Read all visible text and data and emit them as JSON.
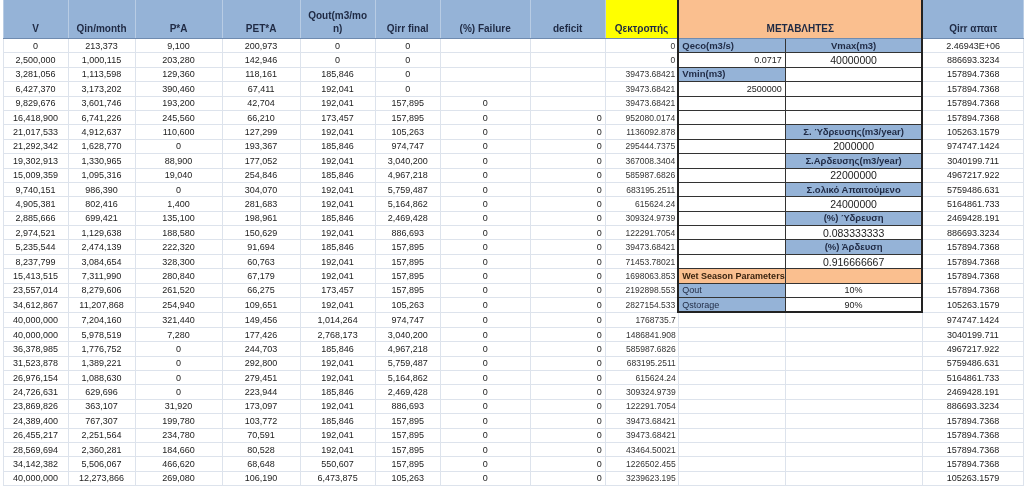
{
  "columns": [
    {
      "label": "V",
      "color": "#95b3d7",
      "kind": "data"
    },
    {
      "label": "Qin/month",
      "color": "#95b3d7",
      "kind": "data"
    },
    {
      "label": "P*A",
      "color": "#95b3d7",
      "kind": "data"
    },
    {
      "label": "PET*A",
      "color": "#95b3d7",
      "kind": "data"
    },
    {
      "label": "Qout(m3/mon)",
      "color": "#95b3d7",
      "kind": "data"
    },
    {
      "label": "Qirr final",
      "color": "#95b3d7",
      "kind": "data"
    },
    {
      "label": "(%) Failure",
      "color": "#95b3d7",
      "kind": "data"
    },
    {
      "label": "deficit",
      "color": "#95b3d7",
      "kind": "data"
    },
    {
      "label": "Qεκτροπής",
      "color": "#ffff00",
      "kind": "data"
    },
    {
      "label": "ΜΕΤΑΒΛΗΤΕΣ",
      "color": "#fabf8f",
      "kind": "group"
    },
    {
      "label": "Qirr απαιτ",
      "color": "#95b3d7",
      "kind": "data"
    }
  ],
  "rows": [
    [
      "0",
      "213,373",
      "9,100",
      "200,973",
      "0",
      "0",
      null,
      null,
      "0",
      "2.46943E+06"
    ],
    [
      "2,500,000",
      "1,000,115",
      "203,280",
      "142,946",
      "0",
      "0",
      null,
      null,
      "0",
      "886693.3234"
    ],
    [
      "3,281,056",
      "1,113,598",
      "129,360",
      "118,161",
      "185,846",
      "0",
      null,
      null,
      "39473.68421",
      "157894.7368"
    ],
    [
      "6,427,370",
      "3,173,202",
      "390,460",
      "67,411",
      "192,041",
      "0",
      null,
      null,
      "39473.68421",
      "157894.7368"
    ],
    [
      "9,829,676",
      "3,601,746",
      "193,200",
      "42,704",
      "192,041",
      "157,895",
      "0",
      null,
      "39473.68421",
      "157894.7368"
    ],
    [
      "16,418,900",
      "6,741,226",
      "245,560",
      "66,210",
      "173,457",
      "157,895",
      "0",
      "0",
      "952080.0174",
      "157894.7368"
    ],
    [
      "21,017,533",
      "4,912,637",
      "110,600",
      "127,299",
      "192,041",
      "105,263",
      "0",
      "0",
      "1136092.878",
      "105263.1579"
    ],
    [
      "21,292,342",
      "1,628,770",
      "0",
      "193,367",
      "185,846",
      "974,747",
      "0",
      "0",
      "295444.7375",
      "974747.1424"
    ],
    [
      "19,302,913",
      "1,330,965",
      "88,900",
      "177,052",
      "192,041",
      "3,040,200",
      "0",
      "0",
      "367008.3404",
      "3040199.711"
    ],
    [
      "15,009,359",
      "1,095,316",
      "19,040",
      "254,846",
      "185,846",
      "4,967,218",
      "0",
      "0",
      "585987.6826",
      "4967217.922"
    ],
    [
      "9,740,151",
      "986,390",
      "0",
      "304,070",
      "192,041",
      "5,759,487",
      "0",
      "0",
      "683195.2511",
      "5759486.631"
    ],
    [
      "4,905,381",
      "802,416",
      "1,400",
      "281,683",
      "192,041",
      "5,164,862",
      "0",
      "0",
      "615624.24",
      "5164861.733"
    ],
    [
      "2,885,666",
      "699,421",
      "135,100",
      "198,961",
      "185,846",
      "2,469,428",
      "0",
      "0",
      "309324.9739",
      "2469428.191"
    ],
    [
      "2,974,521",
      "1,129,638",
      "188,580",
      "150,629",
      "192,041",
      "886,693",
      "0",
      "0",
      "122291.7054",
      "886693.3234"
    ],
    [
      "5,235,544",
      "2,474,139",
      "222,320",
      "91,694",
      "185,846",
      "157,895",
      "0",
      "0",
      "39473.68421",
      "157894.7368"
    ],
    [
      "8,237,799",
      "3,084,654",
      "328,300",
      "60,763",
      "192,041",
      "157,895",
      "0",
      "0",
      "71453.78021",
      "157894.7368"
    ],
    [
      "15,413,515",
      "7,311,990",
      "280,840",
      "67,179",
      "192,041",
      "157,895",
      "0",
      "0",
      "1698063.853",
      "157894.7368"
    ],
    [
      "23,557,014",
      "8,279,606",
      "261,520",
      "66,275",
      "173,457",
      "157,895",
      "0",
      "0",
      "2192898.553",
      "157894.7368"
    ],
    [
      "34,612,867",
      "11,207,868",
      "254,940",
      "109,651",
      "192,041",
      "105,263",
      "0",
      "0",
      "2827154.533",
      "105263.1579"
    ],
    [
      "40,000,000",
      "7,204,160",
      "321,440",
      "149,456",
      "1,014,264",
      "974,747",
      "0",
      "0",
      "1768735.7",
      "974747.1424"
    ],
    [
      "40,000,000",
      "5,978,519",
      "7,280",
      "177,426",
      "2,768,173",
      "3,040,200",
      "0",
      "0",
      "1486841.908",
      "3040199.711"
    ],
    [
      "36,378,985",
      "1,776,752",
      "0",
      "244,703",
      "185,846",
      "4,967,218",
      "0",
      "0",
      "585987.6826",
      "4967217.922"
    ],
    [
      "31,523,878",
      "1,389,221",
      "0",
      "292,800",
      "192,041",
      "5,759,487",
      "0",
      "0",
      "683195.2511",
      "5759486.631"
    ],
    [
      "26,976,154",
      "1,088,630",
      "0",
      "279,451",
      "192,041",
      "5,164,862",
      "0",
      "0",
      "615624.24",
      "5164861.733"
    ],
    [
      "24,726,631",
      "629,696",
      "0",
      "223,944",
      "185,846",
      "2,469,428",
      "0",
      "0",
      "309324.9739",
      "2469428.191"
    ],
    [
      "23,869,826",
      "363,107",
      "31,920",
      "173,097",
      "192,041",
      "886,693",
      "0",
      "0",
      "122291.7054",
      "886693.3234"
    ],
    [
      "24,389,400",
      "767,307",
      "199,780",
      "103,772",
      "185,846",
      "157,895",
      "0",
      "0",
      "39473.68421",
      "157894.7368"
    ],
    [
      "26,455,217",
      "2,251,564",
      "234,780",
      "70,591",
      "192,041",
      "157,895",
      "0",
      "0",
      "39473.68421",
      "157894.7368"
    ],
    [
      "28,569,694",
      "2,360,281",
      "184,660",
      "80,528",
      "192,041",
      "157,895",
      "0",
      "0",
      "43464.50021",
      "157894.7368"
    ],
    [
      "34,142,382",
      "5,506,067",
      "466,620",
      "68,648",
      "550,607",
      "157,895",
      "0",
      "0",
      "1226502.455",
      "157894.7368"
    ],
    [
      "40,000,000",
      "12,273,866",
      "269,080",
      "106,190",
      "6,473,875",
      "105,263",
      "0",
      "0",
      "3239623.195",
      "105263.1579"
    ]
  ],
  "parameters": [
    [
      {
        "kind": "label",
        "text": "Qeco(m3/s)"
      },
      {
        "kind": "label",
        "text": "Vmax(m3)"
      }
    ],
    [
      {
        "kind": "value",
        "text": "0.0717"
      },
      {
        "kind": "big_value",
        "text": "40000000"
      }
    ],
    [
      {
        "kind": "label",
        "text": "Vmin(m3)"
      },
      {
        "kind": "blank"
      }
    ],
    [
      {
        "kind": "value",
        "text": "2500000"
      },
      {
        "kind": "blank"
      }
    ],
    [
      {
        "kind": "blank"
      },
      {
        "kind": "blank"
      }
    ],
    [
      {
        "kind": "blank"
      },
      {
        "kind": "blank"
      }
    ],
    [
      {
        "kind": "blank"
      },
      {
        "kind": "label",
        "text": "Σ. Ύδρευσης(m3/year)"
      }
    ],
    [
      {
        "kind": "blank"
      },
      {
        "kind": "big_value",
        "text": "2000000"
      }
    ],
    [
      {
        "kind": "blank"
      },
      {
        "kind": "label",
        "text": "Σ.Αρδευσης(m3/year)"
      }
    ],
    [
      {
        "kind": "blank"
      },
      {
        "kind": "big_value",
        "text": "22000000"
      }
    ],
    [
      {
        "kind": "blank"
      },
      {
        "kind": "label",
        "text": "Σ.ολικό Απαιτούμενο"
      }
    ],
    [
      {
        "kind": "blank"
      },
      {
        "kind": "big_value",
        "text": "24000000"
      }
    ],
    [
      {
        "kind": "blank"
      },
      {
        "kind": "label",
        "text": "(%) Ύδρευση"
      }
    ],
    [
      {
        "kind": "blank"
      },
      {
        "kind": "big_value",
        "text": "0.083333333"
      }
    ],
    [
      {
        "kind": "blank"
      },
      {
        "kind": "label",
        "text": "(%) Άρδευση"
      }
    ],
    [
      {
        "kind": "blank"
      },
      {
        "kind": "big_value",
        "text": "0.916666667"
      }
    ],
    [
      {
        "kind": "section",
        "text": "Wet Season Parameters"
      },
      {
        "kind": "section"
      }
    ],
    [
      {
        "kind": "sublabel",
        "text": "Qout"
      },
      {
        "kind": "small_value",
        "text": "10%"
      }
    ],
    [
      {
        "kind": "sublabel",
        "text": "Qstorage"
      },
      {
        "kind": "small_value",
        "text": "90%"
      }
    ]
  ]
}
